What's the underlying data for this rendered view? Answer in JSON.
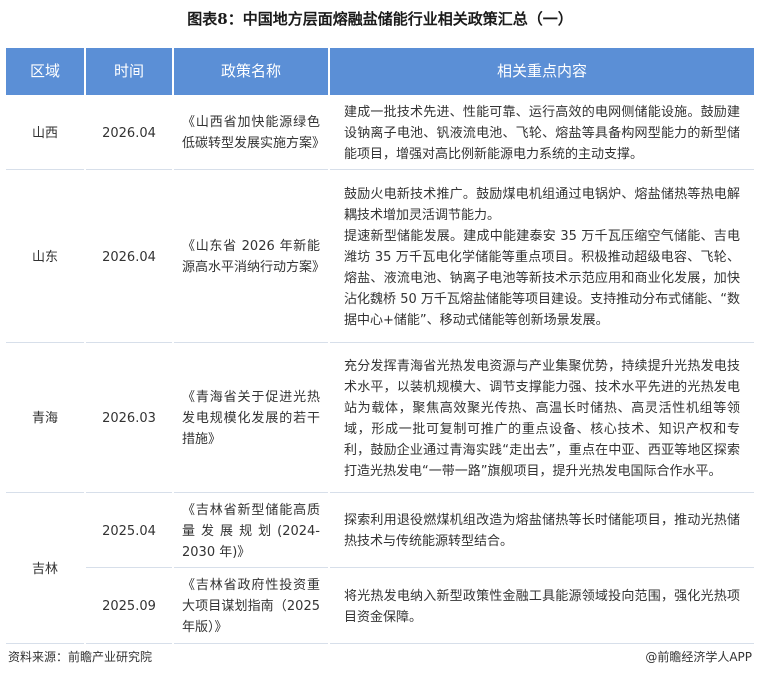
{
  "title": "图表8：中国地方层面熔融盐储能行业相关政策汇总（一）",
  "header": {
    "region": "区域",
    "time": "时间",
    "policy": "政策名称",
    "content": "相关重点内容"
  },
  "rows": [
    {
      "region": "山西",
      "time": "2026.04",
      "policy": "《山西省加快能源绿色低碳转型发展实施方案》",
      "content": [
        "建成一批技术先进、性能可靠、运行高效的电网侧储能设施。鼓励建设钠离子电池、钒液流电池、飞轮、熔盐等具备构网型能力的新型储能项目，增强对高比例新能源电力系统的主动支撑。"
      ]
    },
    {
      "region": "山东",
      "time": "2026.04",
      "policy": "《山东省 2026 年新能源高水平消纳行动方案》",
      "content": [
        "鼓励火电新技术推广。鼓励煤电机组通过电锅炉、熔盐储热等热电解耦技术增加灵活调节能力。",
        "提速新型储能发展。建成中能建泰安 35 万千瓦压缩空气储能、吉电潍坊 35 万千瓦电化学储能等重点项目。积极推动超级电容、飞轮、熔盐、液流电池、钠离子电池等新技术示范应用和商业化发展，加快沾化魏桥 50 万千瓦熔盐储能等项目建设。支持推动分布式储能、“数据中心+储能”、移动式储能等创新场景发展。"
      ]
    },
    {
      "region": "青海",
      "time": "2026.03",
      "policy": "《青海省关于促进光热发电规模化发展的若干措施》",
      "content": [
        "充分发挥青海省光热发电资源与产业集聚优势，持续提升光热发电技术水平，以装机规模大、调节支撑能力强、技术水平先进的光热发电站为载体，聚焦高效聚光传热、高温长时储热、高灵活性机组等领域，形成一批可复制可推广的重点设备、核心技术、知识产权和专利，鼓励企业通过青海实践“走出去”，重点在中亚、西亚等地区探索打造光热发电“一带一路”旗舰项目，提升光热发电国际合作水平。"
      ]
    },
    {
      "region": "吉林",
      "time": "2025.04",
      "policy": "《吉林省新型储能高质量发展规划(2024-2030 年)》",
      "content": [
        "探索利用退役燃煤机组改造为熔盐储热等长时储能项目，推动光热储热技术与传统能源转型结合。"
      ]
    },
    {
      "region": "吉林",
      "time": "2025.09",
      "policy": "《吉林省政府性投资重大项目谋划指南（2025 年版）》",
      "content": [
        "将光热发电纳入新型政策性金融工具能源领域投向范围，强化光热项目资金保障。"
      ]
    }
  ],
  "footer": {
    "source": "资料来源：前瞻产业研究院",
    "brand": "@前瞻经济学人APP"
  }
}
